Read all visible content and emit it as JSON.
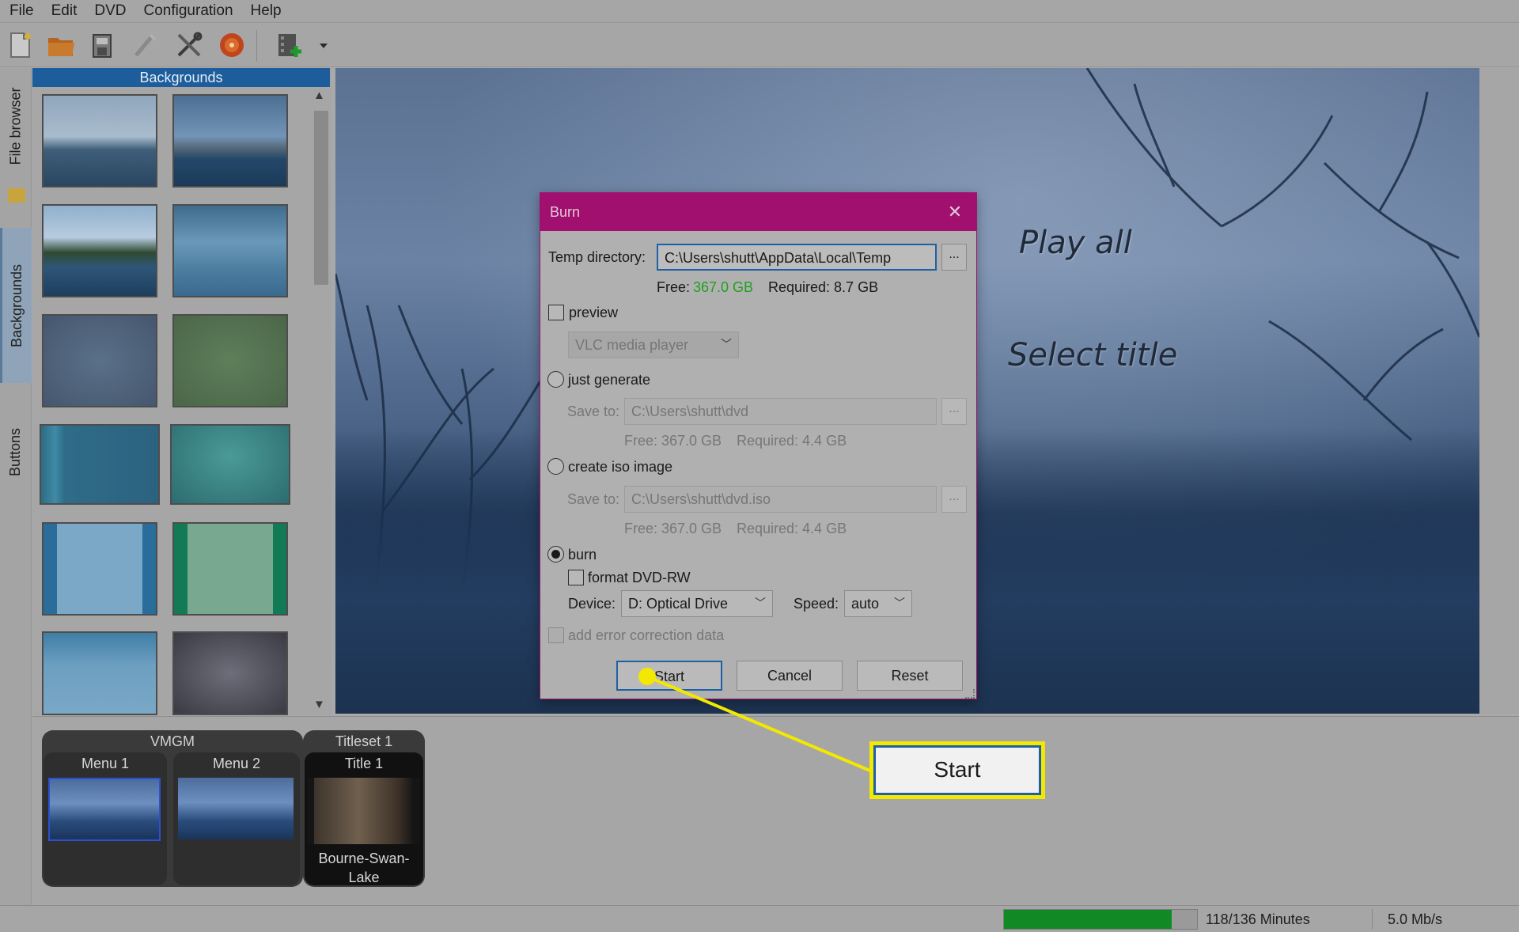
{
  "menubar": {
    "items": [
      "File",
      "Edit",
      "DVD",
      "Configuration",
      "Help"
    ]
  },
  "toolbar": {
    "icons": [
      "new-project-icon",
      "open-folder-icon",
      "save-icon",
      "wand-icon",
      "settings-tools-icon",
      "burn-disc-icon",
      "add-file-icon",
      "dropdown-arrow-icon"
    ]
  },
  "side_tabs": {
    "file_browser": "File browser",
    "backgrounds": "Backgrounds",
    "buttons": "Buttons"
  },
  "backgrounds_panel": {
    "title": "Backgrounds"
  },
  "preview": {
    "play_all": "Play all",
    "select_title": "Select title"
  },
  "bottom": {
    "vmgm_label": "VMGM",
    "titleset_label": "Titleset 1",
    "menus": [
      {
        "label": "Menu 1"
      },
      {
        "label": "Menu 2"
      }
    ],
    "title": {
      "label": "Title 1",
      "caption": "Bourne-Swan-\nLake"
    }
  },
  "status": {
    "minutes": "118/136 Minutes",
    "rate": "5.0 Mb/s",
    "progress_fraction": 0.868
  },
  "burn_dialog": {
    "title": "Burn",
    "temp_dir_label": "Temp directory:",
    "temp_dir_value": "C:\\Users\\shutt\\AppData\\Local\\Temp",
    "browse": "...",
    "temp_free_label": "Free:",
    "temp_free_value": "367.0 GB",
    "temp_required": "Required: 8.7 GB",
    "preview_label": "preview",
    "player_value": "VLC media player",
    "just_generate_label": "just generate",
    "save_to_label": "Save to:",
    "generate_path": "C:\\Users\\shutt\\dvd",
    "generate_free": "Free: 367.0 GB",
    "generate_required": "Required: 4.4 GB",
    "create_iso_label": "create iso image",
    "iso_path": "C:\\Users\\shutt\\dvd.iso",
    "iso_free": "Free: 367.0 GB",
    "iso_required": "Required: 4.4 GB",
    "burn_label": "burn",
    "format_label": "format DVD-RW",
    "device_label": "Device:",
    "device_value": "D: Optical Drive",
    "speed_label": "Speed:",
    "speed_value": "auto",
    "error_correction_label": "add error correction data",
    "start_label": "Start",
    "cancel_label": "Cancel",
    "reset_label": "Reset"
  },
  "callout": {
    "label": "Start",
    "color": "#f3e800"
  }
}
